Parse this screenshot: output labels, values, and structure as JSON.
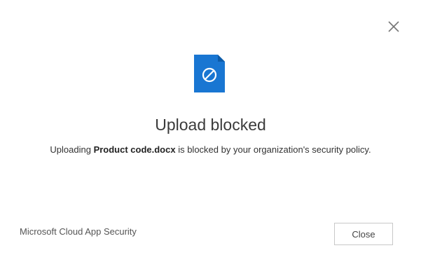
{
  "dialog": {
    "close_icon": "close-icon",
    "file_icon": "blocked-document-icon",
    "title": "Upload blocked",
    "message": {
      "prefix": "Uploading ",
      "filename": "Product code.docx",
      "suffix": " is blocked by your organization's security policy."
    },
    "footer": {
      "brand": "Microsoft Cloud App Security",
      "close_button_label": "Close"
    }
  },
  "colors": {
    "accent": "#1976d2",
    "icon_fold": "#0d5ba8",
    "background": "#ffffff"
  }
}
